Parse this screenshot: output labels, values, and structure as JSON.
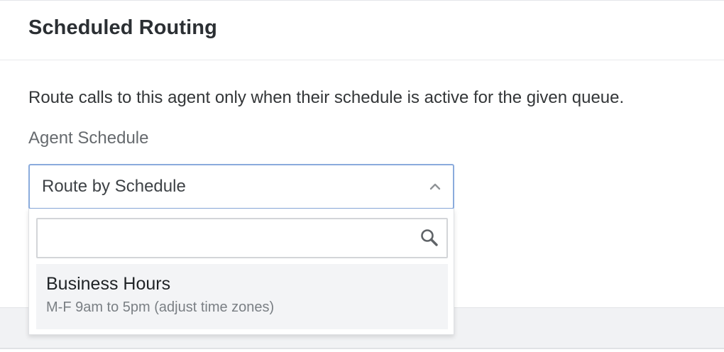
{
  "header": {
    "title": "Scheduled Routing"
  },
  "body": {
    "description": "Route calls to this agent only when their schedule is active for the given queue.",
    "field_label": "Agent Schedule"
  },
  "select": {
    "value": "Route by Schedule",
    "expanded": true,
    "chevron_icon": "chevron-up-icon"
  },
  "dropdown": {
    "search": {
      "value": "",
      "placeholder": "",
      "icon": "search-icon"
    },
    "options": [
      {
        "title": "Business Hours",
        "subtitle": "M-F 9am to 5pm (adjust time zones)",
        "highlighted": true
      }
    ]
  },
  "colors": {
    "focus_border": "#8aabdc",
    "option_highlight": "#f3f4f6",
    "footer_band": "#f1f2f4"
  }
}
